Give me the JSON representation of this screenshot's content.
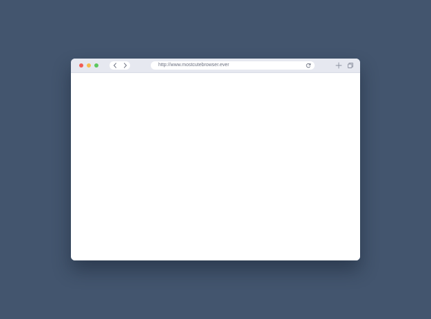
{
  "browser": {
    "window_controls": {
      "close_color": "#f25c54",
      "minimize_color": "#f5be4f",
      "maximize_color": "#5cc85f"
    },
    "navigation": {
      "back_icon": "chevron-left-icon",
      "forward_icon": "chevron-right-icon"
    },
    "address_bar": {
      "url": "http://www.mostcutebrowser.ever",
      "reload_icon": "reload-icon"
    },
    "toolbar_actions": {
      "new_tab_icon": "plus-icon",
      "tabs_icon": "tabs-overview-icon"
    },
    "colors": {
      "background": "#43556e",
      "toolbar": "#e6e8f0",
      "content": "#ffffff"
    }
  }
}
